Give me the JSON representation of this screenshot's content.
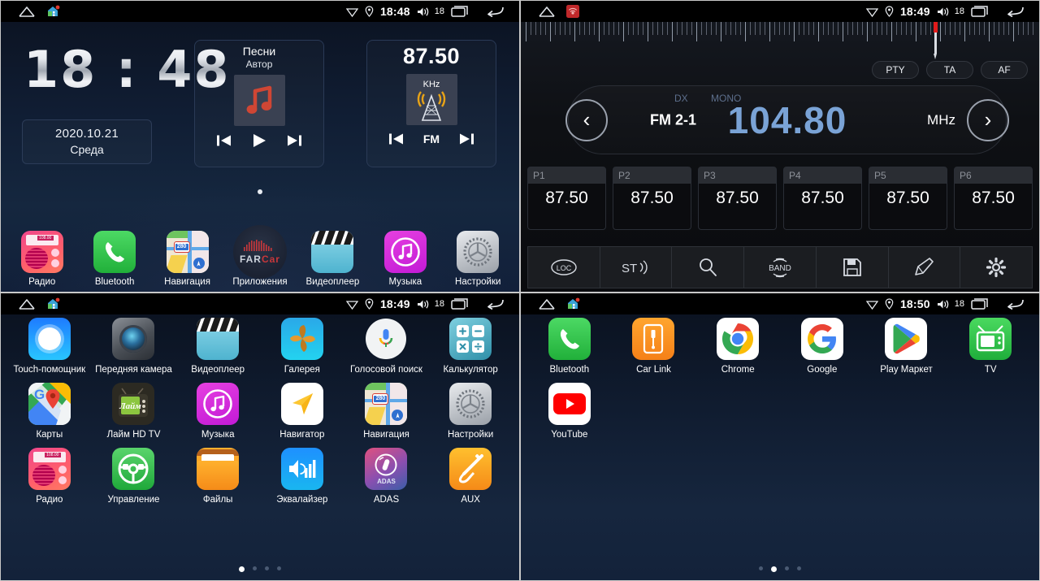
{
  "statusbar": {
    "time_screen1": "18:48",
    "time_screen2": "18:49",
    "time_screen3": "18:49",
    "time_screen4": "18:50",
    "volume": "18",
    "icons": [
      "home-arc-icon",
      "house-icon",
      "wifi-icon",
      "location-icon",
      "volume-icon",
      "recents-icon",
      "back-icon"
    ]
  },
  "home": {
    "clock": "18 : 48",
    "date": "2020.10.21",
    "weekday": "Среда",
    "music_widget": {
      "title": "Песни",
      "artist": "Автор",
      "prev": "prev-icon",
      "play": "play-icon",
      "next": "next-icon"
    },
    "radio_widget": {
      "frequency": "87.50",
      "unit": "KHz",
      "band": "FM",
      "prev": "prev-icon",
      "next": "next-icon"
    },
    "dock": [
      {
        "label": "Радио",
        "icon": "radio-icon"
      },
      {
        "label": "Bluetooth",
        "icon": "phone-icon"
      },
      {
        "label": "Навигация",
        "icon": "apple-maps-icon"
      },
      {
        "label": "Приложения",
        "icon": "farcar-apps-icon"
      },
      {
        "label": "Видеоплеер",
        "icon": "clapperboard-icon"
      },
      {
        "label": "Музыка",
        "icon": "music-note-icon"
      },
      {
        "label": "Настройки",
        "icon": "gear-icon"
      }
    ]
  },
  "radio": {
    "rds_buttons": [
      "PTY",
      "TA",
      "AF"
    ],
    "dx": "DX",
    "mono": "MONO",
    "band": "FM 2-1",
    "frequency": "104.80",
    "unit": "MHz",
    "prev_label": "‹",
    "next_label": "›",
    "presets": [
      {
        "slot": "P1",
        "value": "87.50"
      },
      {
        "slot": "P2",
        "value": "87.50"
      },
      {
        "slot": "P3",
        "value": "87.50"
      },
      {
        "slot": "P4",
        "value": "87.50"
      },
      {
        "slot": "P5",
        "value": "87.50"
      },
      {
        "slot": "P6",
        "value": "87.50"
      }
    ],
    "toolbar": [
      {
        "name": "loc-button",
        "label": "LOC"
      },
      {
        "name": "stereo-button",
        "label": "ST"
      },
      {
        "name": "search-button",
        "label": ""
      },
      {
        "name": "band-button",
        "label": "BAND"
      },
      {
        "name": "save-button",
        "label": ""
      },
      {
        "name": "edit-button",
        "label": ""
      },
      {
        "name": "settings-button",
        "label": ""
      }
    ]
  },
  "apps_page1": {
    "items": [
      {
        "label": "Touch-помощник",
        "icon": "touch-assistant-icon"
      },
      {
        "label": "Передняя камера",
        "icon": "front-camera-icon"
      },
      {
        "label": "Видеоплеер",
        "icon": "clapperboard-icon"
      },
      {
        "label": "Галерея",
        "icon": "gallery-icon"
      },
      {
        "label": "Голосовой поиск",
        "icon": "voice-search-icon"
      },
      {
        "label": "Калькулятор",
        "icon": "calculator-icon"
      },
      {
        "label": "Карты",
        "icon": "google-maps-icon"
      },
      {
        "label": "Лайм HD TV",
        "icon": "lime-hd-tv-icon"
      },
      {
        "label": "Музыка",
        "icon": "music-note-icon"
      },
      {
        "label": "Навигатор",
        "icon": "navigator-arrow-icon"
      },
      {
        "label": "Навигация",
        "icon": "apple-maps-icon"
      },
      {
        "label": "Настройки",
        "icon": "gear-icon"
      },
      {
        "label": "Радио",
        "icon": "radio-icon"
      },
      {
        "label": "Управление",
        "icon": "steering-wheel-icon"
      },
      {
        "label": "Файлы",
        "icon": "folder-icon"
      },
      {
        "label": "Эквалайзер",
        "icon": "equalizer-icon"
      },
      {
        "label": "ADAS",
        "icon": "adas-icon"
      },
      {
        "label": "AUX",
        "icon": "aux-jack-icon"
      }
    ],
    "page_dots": 4,
    "active_dot": 0
  },
  "apps_page2": {
    "items": [
      {
        "label": "Bluetooth",
        "icon": "phone-icon"
      },
      {
        "label": "Car Link",
        "icon": "car-link-icon"
      },
      {
        "label": "Chrome",
        "icon": "chrome-icon"
      },
      {
        "label": "Google",
        "icon": "google-g-icon"
      },
      {
        "label": "Play Маркет",
        "icon": "play-store-icon"
      },
      {
        "label": "TV",
        "icon": "tv-icon"
      },
      {
        "label": "YouTube",
        "icon": "youtube-icon"
      }
    ],
    "page_dots": 4,
    "active_dot": 1
  },
  "colors": {
    "accent_blue": "#7aa3d6",
    "needle_red": "#e11b1b",
    "home_bg": "#101d33",
    "radio_bg": "#0e1014"
  }
}
